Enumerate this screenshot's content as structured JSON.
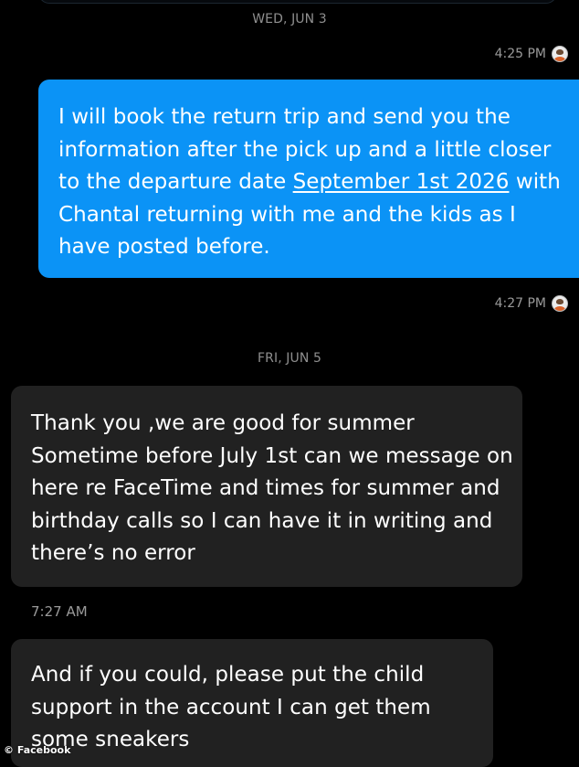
{
  "separators": {
    "wed": "WED, JUN 3",
    "fri": "FRI, JUN 5"
  },
  "timestamps": {
    "first": "4:25 PM",
    "second": "4:27 PM",
    "third": "7:27 AM"
  },
  "messages": {
    "outgoing": {
      "before_link": "I will book the return trip and send you the information after the pick up and a little closer to the departure date ",
      "link": "September 1st 2026",
      "after_link": " with Chantal returning with me and the kids as I have posted before."
    },
    "incoming_1": "Thank you ,we are good for summer Sometime before July 1st can we message on here re FaceTime and times for summer and birthday calls so I can have it in writing and there’s no error",
    "incoming_2": "And if you could, please put the child support in the account I can get them some sneakers"
  },
  "watermark": "© Facebook",
  "colors": {
    "outgoing_bubble": "#0b93f6",
    "incoming_bubble": "#212121",
    "background": "#000000"
  },
  "icons": {
    "avatar": "sender-avatar-icon"
  }
}
